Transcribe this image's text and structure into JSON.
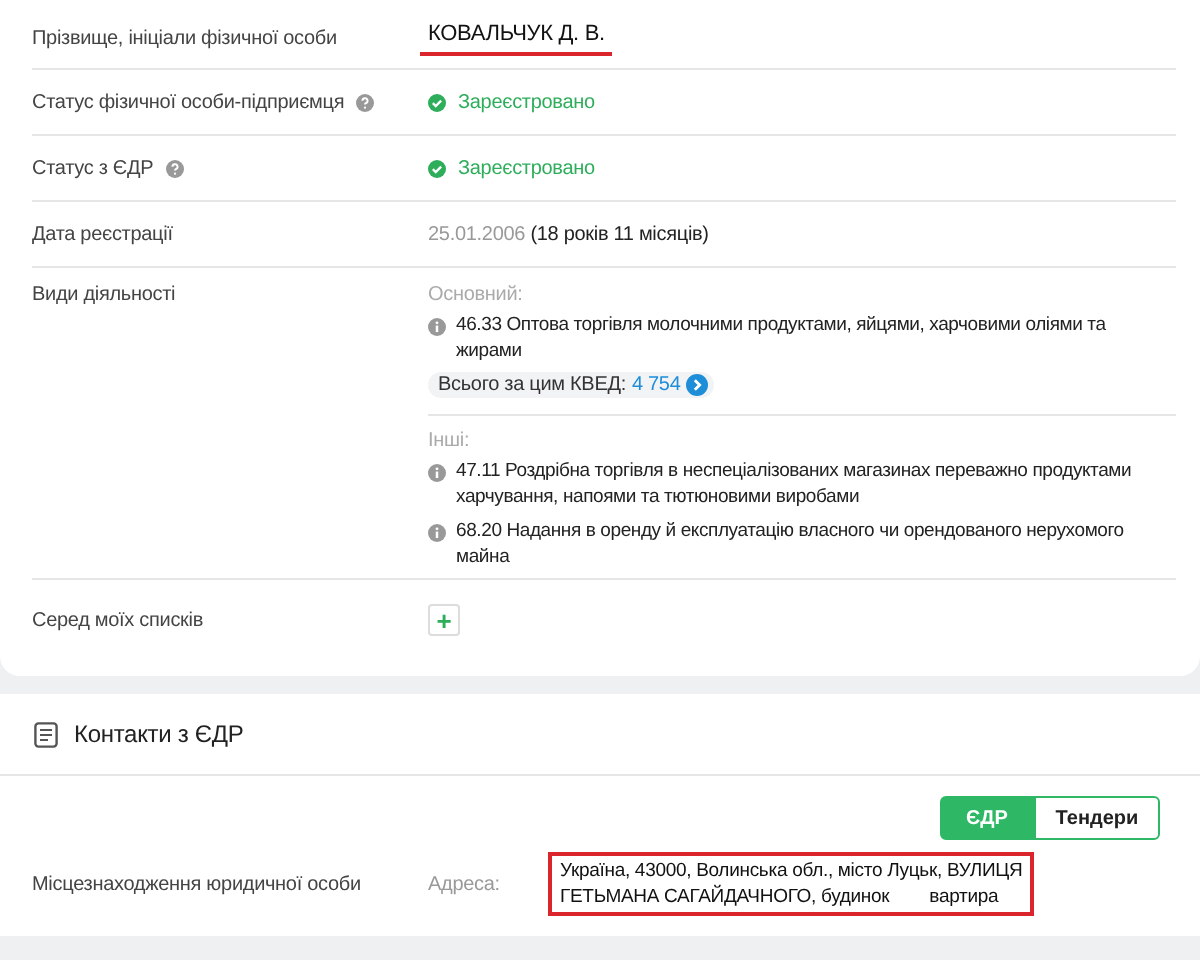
{
  "details": {
    "name_label": "Прізвище, ініціали фізичної особи",
    "name_value": "КОВАЛЬЧУК Д. В.",
    "fop_status_label": "Статус фізичної особи-підприємця",
    "fop_status": {
      "text": "Зареєстровано",
      "registered": true
    },
    "edr_status_label": "Статус з ЄДР",
    "edr_status": {
      "text": "Зареєстровано",
      "registered": true
    },
    "date_label": "Дата реєстрації",
    "date": "25.01.2006",
    "age": "(18 років 11 місяців)",
    "activities_label": "Види діяльності",
    "primary_heading": "Основний:",
    "primary": "46.33 Оптова торгівля молочними продуктами, яйцями, харчовими оліями та жирами",
    "kved_total_label": "Всього за цим КВЕД:",
    "kved_total": "4 754",
    "others_heading": "Інші:",
    "others": [
      "47.11 Роздрібна торгівля в неспеціалізованих магазинах переважно продуктами харчування, напоями та тютюновими виробами",
      "68.20 Надання в оренду й експлуатацію власного чи орендованого нерухомого майна"
    ],
    "lists_label": "Серед моїх списків",
    "add_symbol": "+"
  },
  "contacts": {
    "title": "Контакти з ЄДР",
    "tabs": [
      {
        "label": "ЄДР",
        "selected": true
      },
      {
        "label": "Тендери",
        "selected": false
      }
    ],
    "location_label": "Місцезнаходження юридичної особи",
    "address_label": "Адреса:",
    "address_line1": "Україна, 43000, Волинська обл., місто Луцьк, ВУЛИЦЯ",
    "address_line2_start": "ГЕТЬМАНА САГАЙДАЧНОГО, будинок",
    "address_line2_end": "вартира"
  }
}
